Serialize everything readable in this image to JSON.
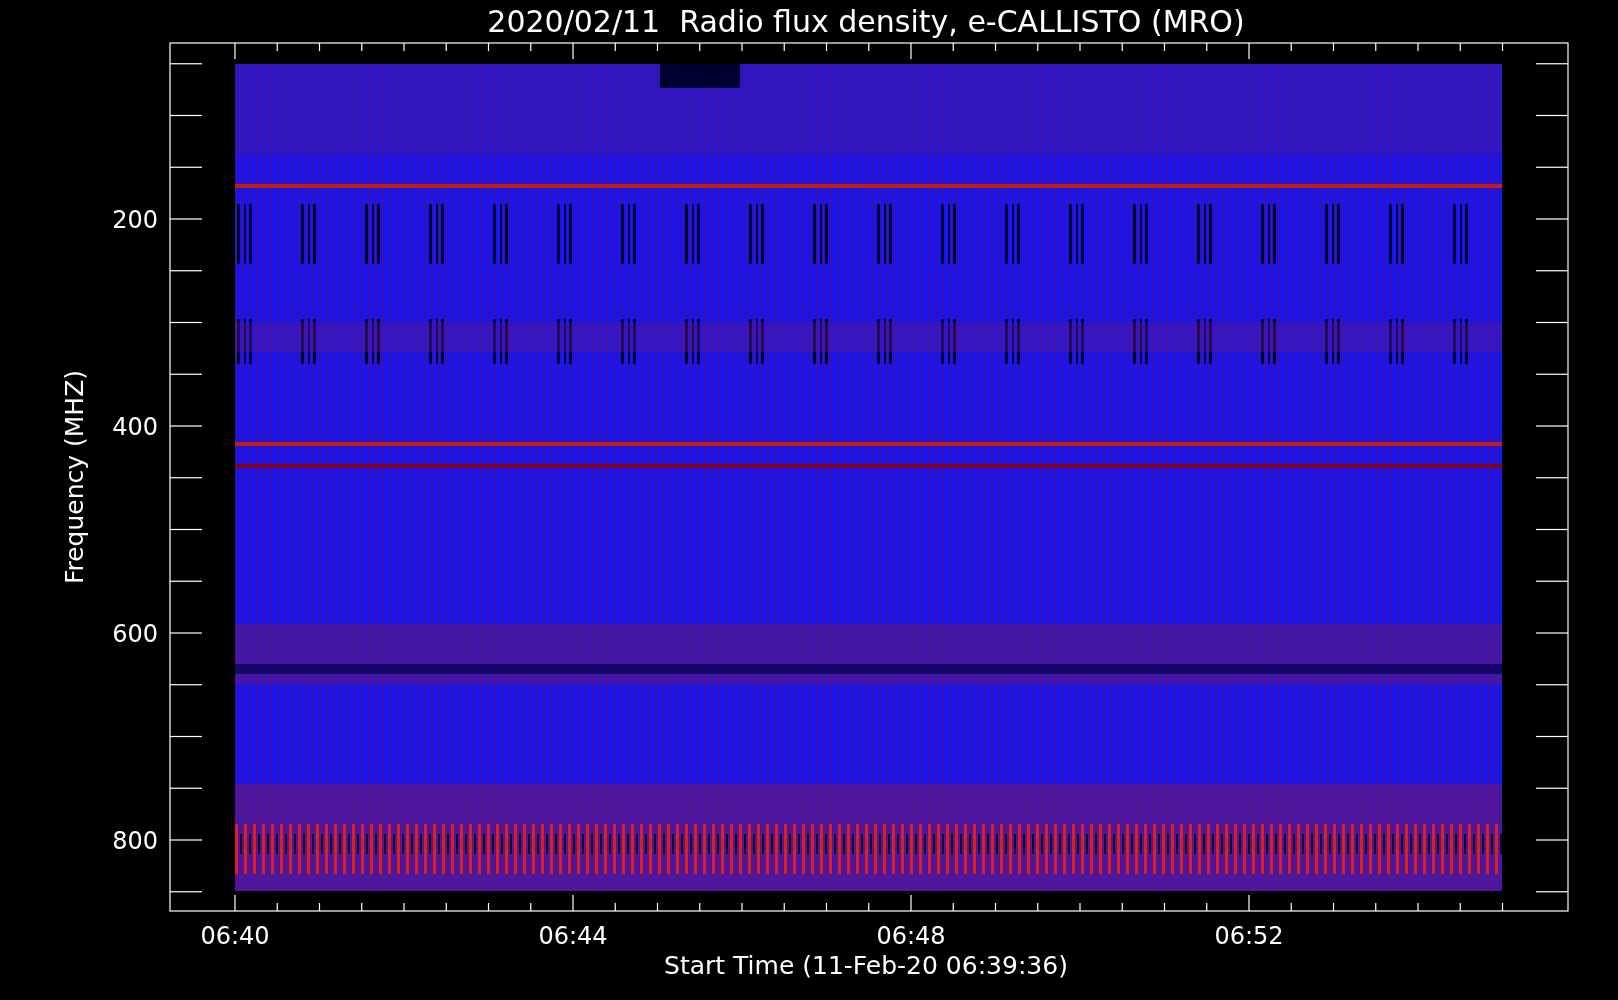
{
  "title": "2020/02/11  Radio flux density, e-CALLISTO (MRO)",
  "xlabel": "Start Time (11-Feb-20 06:39:36)",
  "ylabel": "Frequency (MHZ)",
  "xticks": [
    "06:40",
    "06:44",
    "06:48",
    "06:52"
  ],
  "yticks": [
    "200",
    "400",
    "600",
    "800"
  ]
}
